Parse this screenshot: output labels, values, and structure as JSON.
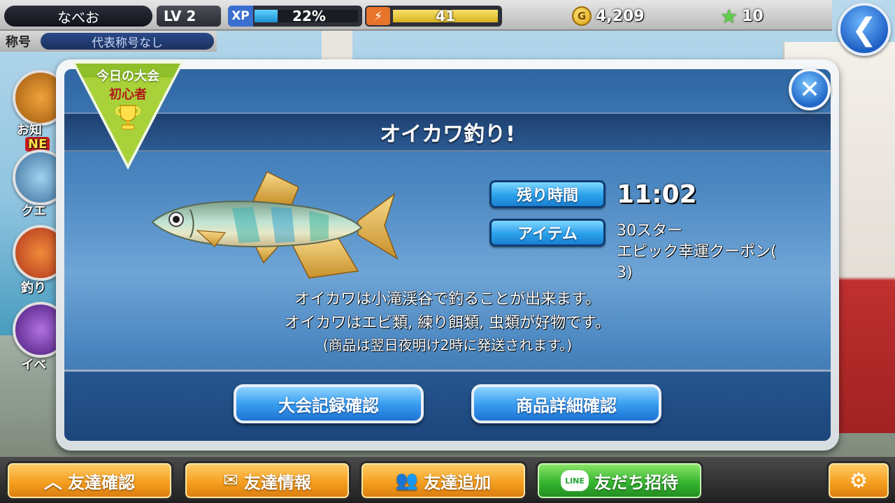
{
  "player": {
    "name": "なべお",
    "level": "LV 2",
    "xp_tag": "XP",
    "xp_percent_text": "22%",
    "xp_fraction": 0.22,
    "energy": "41",
    "gold": "4,209",
    "stars": "10",
    "title_label": "称号",
    "title_value": "代表称号なし"
  },
  "side_menu": {
    "notice_label": "お知",
    "new_badge": "NE",
    "quest_label": "クエ",
    "fishing_label": "釣り",
    "event_label": "イベ"
  },
  "dialog": {
    "ribbon_line1": "今日の大会",
    "ribbon_line2": "初心者",
    "title": "オイカワ釣り!",
    "time_label": "残り時間",
    "time_value": "11:02",
    "item_label": "アイテム",
    "item_line1": "30スター",
    "item_line2": "エピック幸運クーポン(",
    "item_line3": "3)",
    "desc_line1": "オイカワは小滝渓谷で釣ることが出来ます。",
    "desc_line2": "オイカワはエビ類, 練り餌類, 虫類が好物です。",
    "desc_line3": "(商品は翌日夜明け2時に発送されます。)",
    "btn_records": "大会記録確認",
    "btn_prizes": "商品詳細確認",
    "close_glyph": "✕"
  },
  "bottom_nav": {
    "friends_check": "友達確認",
    "friends_info": "友達情報",
    "friends_add": "友達追加",
    "invite": "友だち招待",
    "line_badge": "LINE"
  },
  "colors": {
    "accent_blue": "#2aa0ea",
    "nav_orange": "#f59f1f",
    "nav_green": "#36b531",
    "ribbon_green": "#a9d23a"
  }
}
